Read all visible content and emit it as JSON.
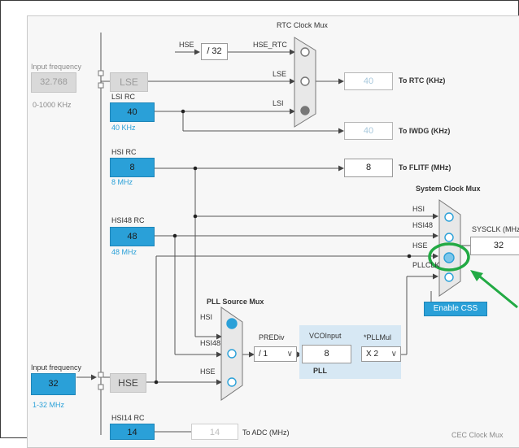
{
  "rtc_mux": {
    "title": "RTC Clock Mux",
    "hse_label": "HSE",
    "div_value": "/ 32",
    "hse_rtc_label": "HSE_RTC",
    "lse_label": "LSE",
    "lsi_label": "LSI",
    "rtc_value": "40",
    "rtc_label": "To RTC (KHz)",
    "iwdg_value": "40",
    "iwdg_label": "To IWDG (KHz)"
  },
  "lse": {
    "input_freq_label": "Input frequency",
    "input_value": "32.768",
    "range": "0-1000 KHz",
    "label": "LSE"
  },
  "lsi": {
    "title": "LSI RC",
    "value": "40",
    "sub": "40 KHz"
  },
  "hsi": {
    "title": "HSI RC",
    "value": "8",
    "sub": "8 MHz"
  },
  "flitf": {
    "value": "8",
    "label": "To FLITF (MHz)"
  },
  "hsi48": {
    "title": "HSI48 RC",
    "value": "48",
    "sub": "48 MHz"
  },
  "sysclk_mux": {
    "title": "System Clock Mux",
    "in_hsi": "HSI",
    "in_hsi48": "HSI48",
    "in_hse": "HSE",
    "in_pllclk": "PLLCLK",
    "sysclk_label": "SYSCLK (MHz)",
    "sysclk_value": "32",
    "enable_css": "Enable CSS"
  },
  "pll_mux": {
    "title": "PLL Source Mux",
    "in_hsi": "HSI",
    "in_hsi48": "HSI48",
    "in_hse": "HSE"
  },
  "pll": {
    "prediv_label": "PREDiv",
    "prediv_value": "/ 1",
    "vco_label": "VCOInput",
    "vco_value": "8",
    "pllmul_label": "*PLLMul",
    "pllmul_value": "X 2",
    "pll_label": "PLL"
  },
  "hse": {
    "input_freq_label": "Input frequency",
    "input_value": "32",
    "range": "1-32 MHz",
    "label": "HSE"
  },
  "hsi14": {
    "title": "HSI14 RC",
    "value": "14",
    "adc_value": "14",
    "adc_label": "To ADC (MHz)"
  },
  "cec_mux": {
    "title": "CEC Clock Mux"
  },
  "colors": {
    "accent": "#2aa0d8",
    "highlight": "#22aa44"
  }
}
